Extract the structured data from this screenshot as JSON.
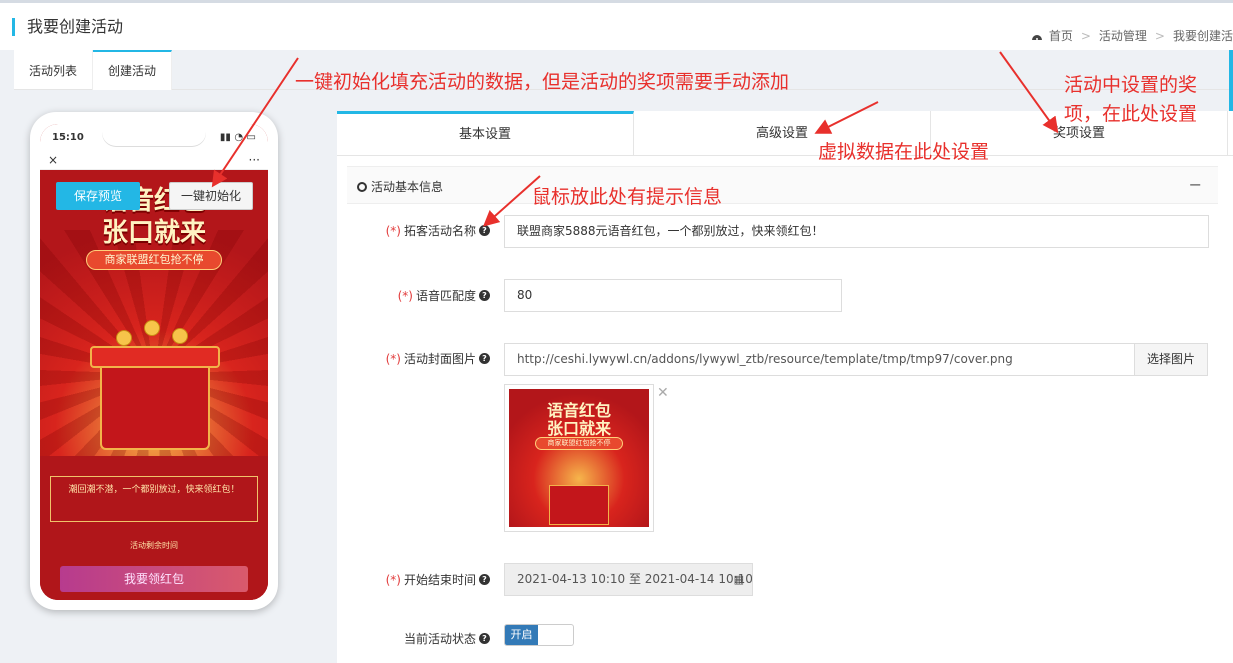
{
  "header": {
    "title": "我要创建活动",
    "breadcrumb": [
      "首页",
      "活动管理",
      "我要创建活"
    ]
  },
  "tabs": [
    "活动列表",
    "创建活动"
  ],
  "phone": {
    "time": "15:10",
    "close": "×",
    "more": "···",
    "poster_title_1": "语音红包",
    "poster_title_2": "张口就来",
    "poster_subtitle": "商家联盟红包抢不停",
    "slogan": "潮回潮不潜，一个都别放过，快来领红包！",
    "countdown_label": "活动剩余时间",
    "cta": "我要领红包",
    "save_preview": "保存预览",
    "one_key_init": "一键初始化"
  },
  "panel": {
    "tabs": [
      "基本设置",
      "高级设置",
      "奖项设置"
    ],
    "section_title": "活动基本信息",
    "collapse": "−",
    "fields": {
      "name_label": "拓客活动名称",
      "name_value": "联盟商家5888元语音红包，一个都别放过，快来领红包！",
      "match_label": "语音匹配度",
      "match_value": "80",
      "cover_label": "活动封面图片",
      "cover_value": "http://ceshi.lywywl.cn/addons/lywywl_ztb/resource/template/tmp/tmp97/cover.png",
      "choose_image": "选择图片",
      "time_label": "开始结束时间",
      "time_value": "2021-04-13 10:10 至 2021-04-14 10:10",
      "status_label": "当前活动状态",
      "status_value": "开启",
      "required_mark": "(*)"
    },
    "thumb": {
      "title_1": "语音红包",
      "title_2": "张口就来",
      "subtitle": "商家联盟红包抢不停"
    }
  },
  "annotations": {
    "a1": "一键初始化填充活动的数据，但是活动的奖项需要手动添加",
    "a2": "活动中设置的奖",
    "a3": "项，在此处设置",
    "a4": "虚拟数据在此处设置",
    "a5": "鼠标放此处有提示信息"
  },
  "colors": {
    "accent": "#23b7e5",
    "annotation": "#e8302c",
    "required": "#e23c3c"
  }
}
